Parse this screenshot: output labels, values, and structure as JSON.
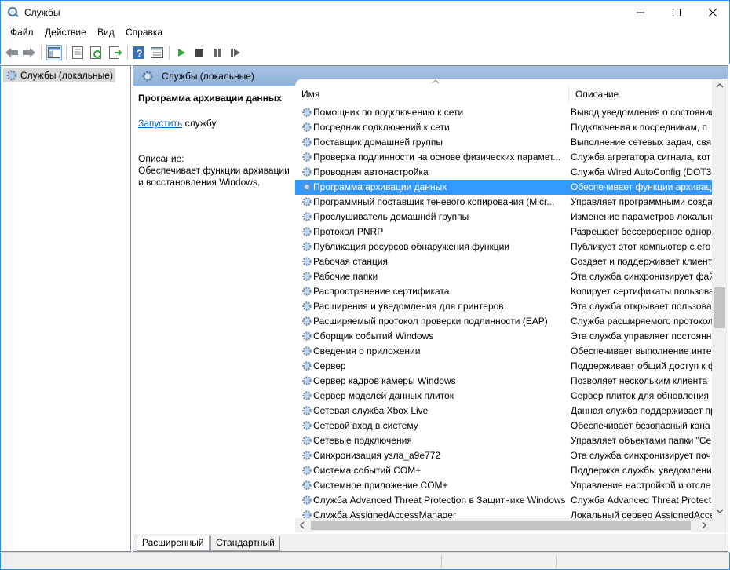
{
  "window": {
    "title": "Службы"
  },
  "menu": [
    "Файл",
    "Действие",
    "Вид",
    "Справка"
  ],
  "toolbar_icons": [
    "back-icon",
    "forward-icon",
    "console-tree-icon",
    "properties-icon",
    "refresh-icon",
    "export-icon",
    "help-icon",
    "view-icon",
    "start-service-icon",
    "stop-service-icon",
    "pause-service-icon",
    "restart-service-icon"
  ],
  "tree": {
    "root": "Службы (локальные)"
  },
  "pane": {
    "header": "Службы (локальные)"
  },
  "details": {
    "service_name": "Программа архивации данных",
    "start_link": "Запустить",
    "start_suffix": " службу",
    "description_label": "Описание:",
    "description_text": "Обеспечивает функции архивации и восстановления Windows."
  },
  "columns": {
    "name": "Имя",
    "description": "Описание"
  },
  "services": [
    {
      "name": "Помощник по подключению к сети",
      "desc": "Вывод уведомления о состоянии"
    },
    {
      "name": "Посредник подключений к сети",
      "desc": "Подключения к посредникам, п"
    },
    {
      "name": "Поставщик домашней группы",
      "desc": "Выполнение сетевых задач, связ"
    },
    {
      "name": "Проверка подлинности на основе физических парамет...",
      "desc": "Служба агрегатора сигнала, кот"
    },
    {
      "name": "Проводная автонастройка",
      "desc": "Служба Wired AutoConfig (DOT3"
    },
    {
      "name": "Программа архивации данных",
      "desc": "Обеспечивает функции архивац",
      "selected": true
    },
    {
      "name": "Программный поставщик теневого копирования (Micr...",
      "desc": "Управляет программными созда"
    },
    {
      "name": "Прослушиватель домашней группы",
      "desc": "Изменение параметров локальн"
    },
    {
      "name": "Протокол PNRP",
      "desc": "Разрешает бесcерверное однора"
    },
    {
      "name": "Публикация ресурсов обнаружения функции",
      "desc": "Публикует этот компьютер с его"
    },
    {
      "name": "Рабочая станция",
      "desc": "Создает и поддерживает клиенто"
    },
    {
      "name": "Рабочие папки",
      "desc": "Эта служба синхронизирует фай"
    },
    {
      "name": "Распространение сертификата",
      "desc": "Копирует сертификаты пользова"
    },
    {
      "name": "Расширения и уведомления для принтеров",
      "desc": "Эта служба открывает пользова"
    },
    {
      "name": "Расширяемый протокол проверки подлинности (EAP)",
      "desc": "Служба расширяемого протокола"
    },
    {
      "name": "Сборщик событий Windows",
      "desc": "Эта служба управляет постоянн"
    },
    {
      "name": "Сведения о приложении",
      "desc": "Обеспечивает выполнение инте"
    },
    {
      "name": "Сервер",
      "desc": "Поддерживает общий доступ к ф"
    },
    {
      "name": "Сервер кадров камеры Windows",
      "desc": "Позволяет нескольким клиента"
    },
    {
      "name": "Сервер моделей данных плиток",
      "desc": "Сервер плиток для обновления пл"
    },
    {
      "name": "Сетевая служба Xbox Live",
      "desc": "Данная служба поддерживает пр"
    },
    {
      "name": "Сетевой вход в систему",
      "desc": "Обеспечивает безопасный кана"
    },
    {
      "name": "Сетевые подключения",
      "desc": "Управляет объектами папки \"Се"
    },
    {
      "name": "Синхронизация узла_a9e772",
      "desc": "Эта служба синхронизирует поч"
    },
    {
      "name": "Система событий COM+",
      "desc": "Поддержка службы уведомлени"
    },
    {
      "name": "Системное приложение COM+",
      "desc": "Управление настройкой и отсле"
    },
    {
      "name": "Служба Advanced Threat Protection в Защитнике Windows",
      "desc": "Служба Advanced Threat Protect"
    },
    {
      "name": "Служба AssignedAccessManager",
      "desc": "Локальный сервер AssignedAcce"
    }
  ],
  "tabs": [
    "Расширенный",
    "Стандартный"
  ]
}
